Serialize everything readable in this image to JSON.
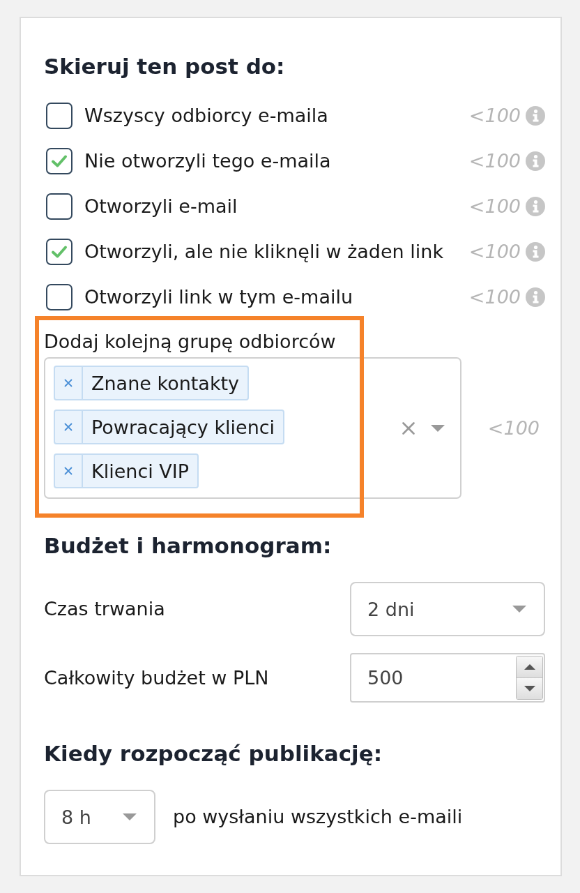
{
  "audience": {
    "heading": "Skieruj ten post do:",
    "options": [
      {
        "label": "Wszyscy odbiorcy e-maila",
        "checked": false,
        "estimate": "<100"
      },
      {
        "label": "Nie otworzyli tego e-maila",
        "checked": true,
        "estimate": "<100"
      },
      {
        "label": "Otworzyli e-mail",
        "checked": false,
        "estimate": "<100"
      },
      {
        "label": "Otworzyli, ale nie kliknęli w żaden link",
        "checked": true,
        "estimate": "<100"
      },
      {
        "label": "Otworzyli link w tym e-mailu",
        "checked": false,
        "estimate": "<100"
      }
    ]
  },
  "extra_group": {
    "label": "Dodaj kolejną grupę odbiorców",
    "highlighted": true,
    "tags": [
      {
        "label": "Znane kontakty"
      },
      {
        "label": "Powracający klienci"
      },
      {
        "label": "Klienci VIP"
      }
    ],
    "estimate": "<100"
  },
  "budget": {
    "heading": "Budżet i harmonogram:",
    "fields": [
      {
        "kind": "select",
        "label": "Czas trwania",
        "value": "2 dni"
      },
      {
        "kind": "number",
        "label": "Całkowity budżet w PLN",
        "value": "500"
      }
    ]
  },
  "start": {
    "heading": "Kiedy rozpocząć publikację:",
    "delay": {
      "value": "8 h"
    },
    "suffix": "po wysłaniu wszystkich e-maili"
  }
}
